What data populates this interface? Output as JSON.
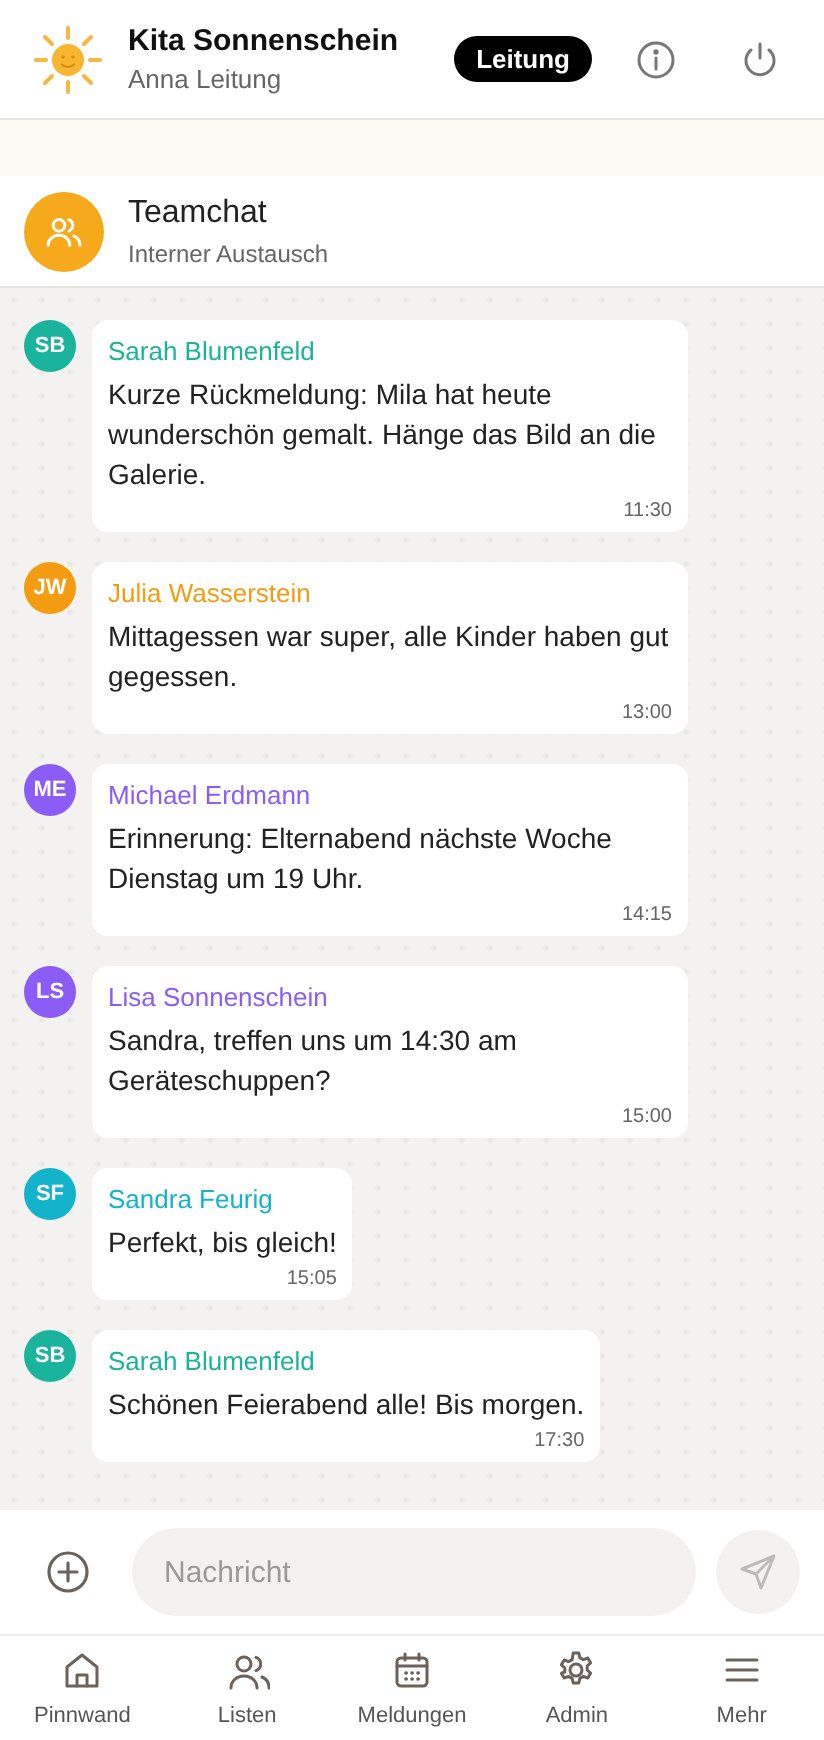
{
  "header": {
    "title": "Kita Sonnenschein",
    "subtitle": "Anna Leitung",
    "role_badge": "Leitung"
  },
  "chat": {
    "title": "Teamchat",
    "subtitle": "Interner Austausch"
  },
  "messages": [
    {
      "initials": "SB",
      "sender": "Sarah Blumenfeld",
      "color": "#1ab39c",
      "text": "Kurze Rückmeldung: Mila hat heute wunderschön gemalt. Hänge das Bild an die Galerie.",
      "time": "11:30"
    },
    {
      "initials": "JW",
      "sender": "Julia Wasserstein",
      "color": "#f39c12",
      "text": "Mittagessen war super, alle Kinder haben gut gegessen.",
      "time": "13:00"
    },
    {
      "initials": "ME",
      "sender": "Michael Erdmann",
      "color": "#8b5cf6",
      "text": "Erinnerung: Elternabend nächste Woche Dienstag um 19 Uhr.",
      "time": "14:15"
    },
    {
      "initials": "LS",
      "sender": "Lisa Sonnenschein",
      "color": "#8b5cf6",
      "text": "Sandra, treffen uns um 14:30 am Geräteschuppen?",
      "time": "15:00"
    },
    {
      "initials": "SF",
      "sender": "Sandra Feurig",
      "color": "#14b3cc",
      "text": "Perfekt, bis gleich!",
      "time": "15:05"
    },
    {
      "initials": "SB",
      "sender": "Sarah Blumenfeld",
      "color": "#1ab39c",
      "text": "Schönen Feierabend alle! Bis morgen.",
      "time": "17:30"
    }
  ],
  "composer": {
    "placeholder": "Nachricht"
  },
  "nav": [
    {
      "kind": "home",
      "label": "Pinnwand",
      "selected": false
    },
    {
      "kind": "people",
      "label": "Listen",
      "selected": false
    },
    {
      "kind": "calendar",
      "label": "Meldungen",
      "selected": false
    },
    {
      "kind": "gear",
      "label": "Admin",
      "selected": false
    },
    {
      "kind": "menu",
      "label": "Mehr",
      "selected": false
    }
  ]
}
